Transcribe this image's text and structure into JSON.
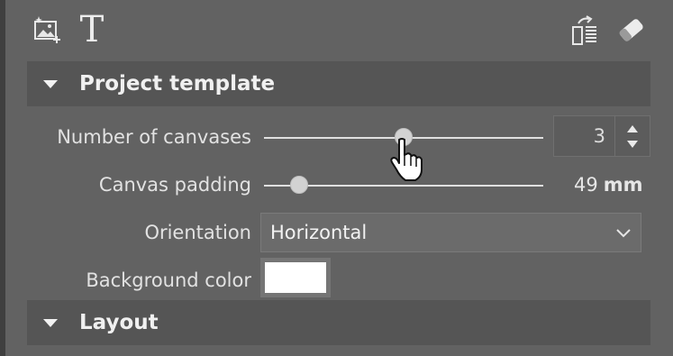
{
  "toolbar": {
    "left_icons": [
      "add-image-icon",
      "text-tool-icon"
    ],
    "right_icons": [
      "flip-layout-icon",
      "eraser-icon"
    ],
    "text_glyph": "T"
  },
  "sections": {
    "project_template": {
      "title": "Project template",
      "expanded": true
    },
    "layout": {
      "title": "Layout",
      "expanded": false
    }
  },
  "settings": {
    "num_canvases": {
      "label": "Number of canvases",
      "value": "3",
      "slider_fraction": 0.49
    },
    "canvas_padding": {
      "label": "Canvas padding",
      "value": "49",
      "unit": "mm",
      "slider_fraction": 0.13
    },
    "orientation": {
      "label": "Orientation",
      "value": "Horizontal"
    },
    "background_color": {
      "label": "Background color",
      "value": "#ffffff"
    }
  },
  "colors": {
    "panel_bg": "#626262",
    "section_bg": "#555555",
    "accent_text": "#f0f0f0"
  }
}
